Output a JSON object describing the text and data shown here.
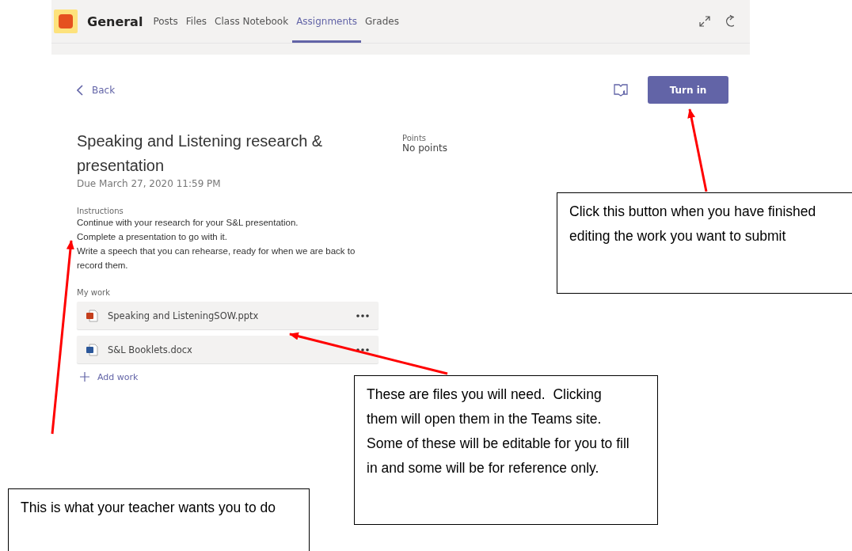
{
  "header": {
    "channel": "General",
    "tabs": [
      {
        "label": "Posts",
        "selected": false
      },
      {
        "label": "Files",
        "selected": false
      },
      {
        "label": "Class Notebook",
        "selected": false
      },
      {
        "label": "Assignments",
        "selected": true
      },
      {
        "label": "Grades",
        "selected": false
      }
    ]
  },
  "assignment": {
    "back": "Back",
    "turn_in": "Turn in",
    "title": "Speaking and Listening research & presentation",
    "due": "Due March 27, 2020 11:59 PM",
    "points_label": "Points",
    "points": "No points",
    "instructions_label": "Instructions",
    "instructions": [
      "Continue with your research for your S&L presentation.",
      "Complete a presentation to go with it.",
      "Write a speech that you can rehearse, ready for when we are back to record them."
    ],
    "my_work_label": "My work",
    "files": [
      {
        "name": "Speaking and ListeningSOW.pptx",
        "kind": "pptx"
      },
      {
        "name": "S&L Booklets.docx",
        "kind": "docx"
      }
    ],
    "add_work": "Add work"
  },
  "annotations": [
    "Click this button when you have finished editing the work you want to submit",
    "These are files you will need.  Clicking them will open them in the Teams site.  Some of these will be editable for you to fill in and some will be for reference only.",
    "This is what your teacher wants you to do"
  ]
}
